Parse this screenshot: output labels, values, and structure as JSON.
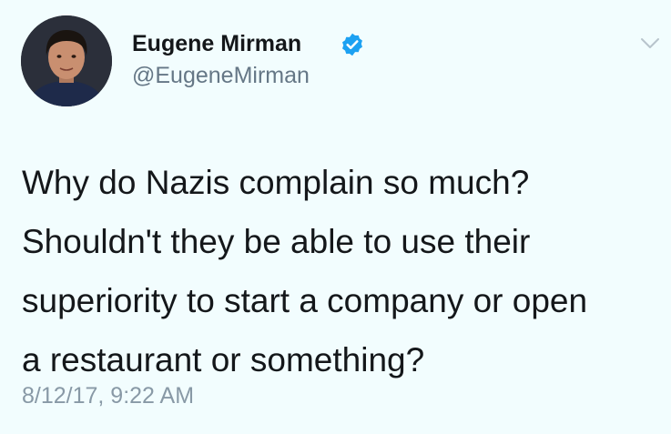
{
  "author": {
    "display_name": "Eugene Mirman",
    "handle": "@EugeneMirman",
    "verified": true,
    "avatar_icon": "profile-photo"
  },
  "tweet": {
    "lines": [
      "Why do Nazis complain so much?",
      "Shouldn't they be able to use their",
      "superiority to start a company or open",
      "a restaurant or something?"
    ],
    "timestamp": "8/12/17, 9:22 AM"
  },
  "menu": {
    "icon": "chevron-down-icon"
  },
  "colors": {
    "background": "#f2fdfe",
    "verified": "#1da1f2",
    "text": "#14171a",
    "secondary": "#657786",
    "timestamp": "#8899a6"
  }
}
